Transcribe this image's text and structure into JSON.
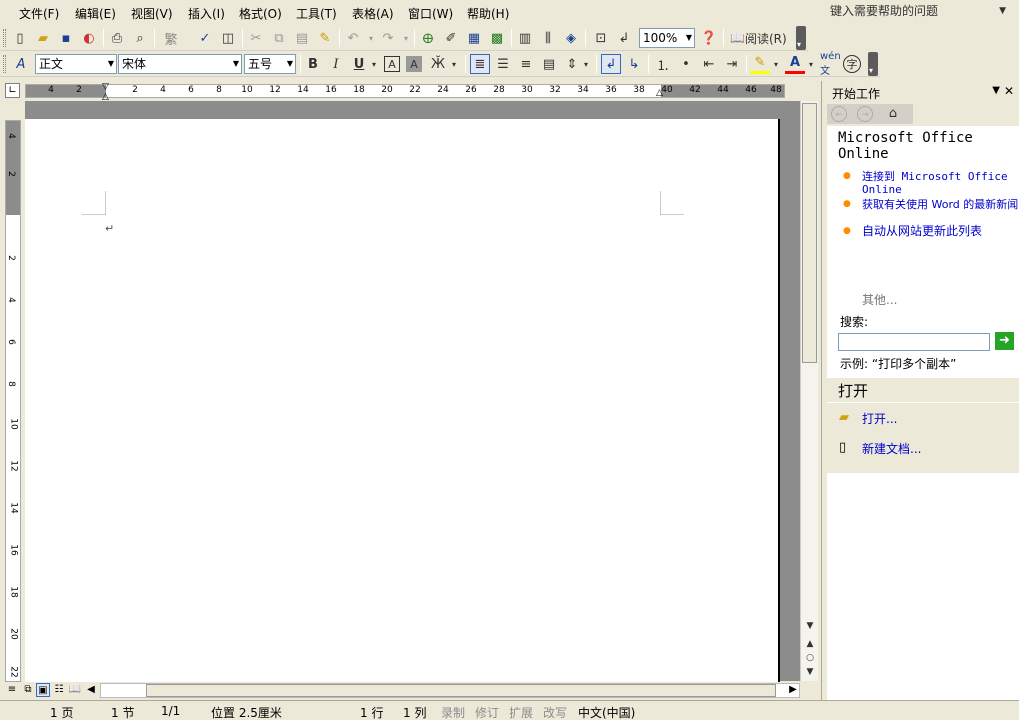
{
  "menu": {
    "items": [
      "文件(F)",
      "编辑(E)",
      "视图(V)",
      "插入(I)",
      "格式(O)",
      "工具(T)",
      "表格(A)",
      "窗口(W)",
      "帮助(H)"
    ]
  },
  "help_box": {
    "placeholder": "键入需要帮助的问题"
  },
  "standard_toolbar": {
    "zoom": "100%",
    "read_label": "阅读(R)"
  },
  "formatting_toolbar": {
    "style": "正文",
    "font": "宋体",
    "size": "五号",
    "bold": "B",
    "italic": "I",
    "underline": "U",
    "char_border": "A",
    "char_shading": "A",
    "font_color": "A",
    "wen_label": "wén 文",
    "enclose_char": "字"
  },
  "ruler": {
    "h_ticks": [
      "4",
      "2",
      "2",
      "4",
      "6",
      "8",
      "10",
      "12",
      "14",
      "16",
      "18",
      "20",
      "22",
      "24",
      "26",
      "28",
      "30",
      "32",
      "34",
      "36",
      "38",
      "40",
      "42",
      "44",
      "46",
      "48"
    ],
    "v_ticks": [
      "4",
      "2",
      "2",
      "4",
      "6",
      "8",
      "10",
      "12",
      "14",
      "16",
      "18",
      "20",
      "22"
    ]
  },
  "document": {
    "paragraph_mark": "↵"
  },
  "status_bar": {
    "page": "1 页",
    "section": "1 节",
    "page_of": "1/1",
    "position": "位置 2.5厘米",
    "line": "1 行",
    "column": "1 列",
    "rec": "录制",
    "trk": "修订",
    "ext": "扩展",
    "ovr": "改写",
    "language": "中文(中国)"
  },
  "task_pane": {
    "title": "开始工作",
    "online_title": "Microsoft Office Online",
    "links": [
      "连接到 Microsoft Office Online",
      "获取有关使用 Word 的最新新闻",
      "自动从网站更新此列表"
    ],
    "more": "其他...",
    "search_label": "搜索:",
    "search_value": "",
    "example": "示例:  “打印多个副本”",
    "open_section_title": "打开",
    "open_link": "打开...",
    "new_doc_link": "新建文档..."
  },
  "colors": {
    "chrome": "#ece9d8",
    "link": "#0000cc",
    "bullet": "#ff8c00",
    "go_button": "#26a426",
    "font_color_bar": "#ff0000",
    "highlight_bar": "#ffff00"
  }
}
